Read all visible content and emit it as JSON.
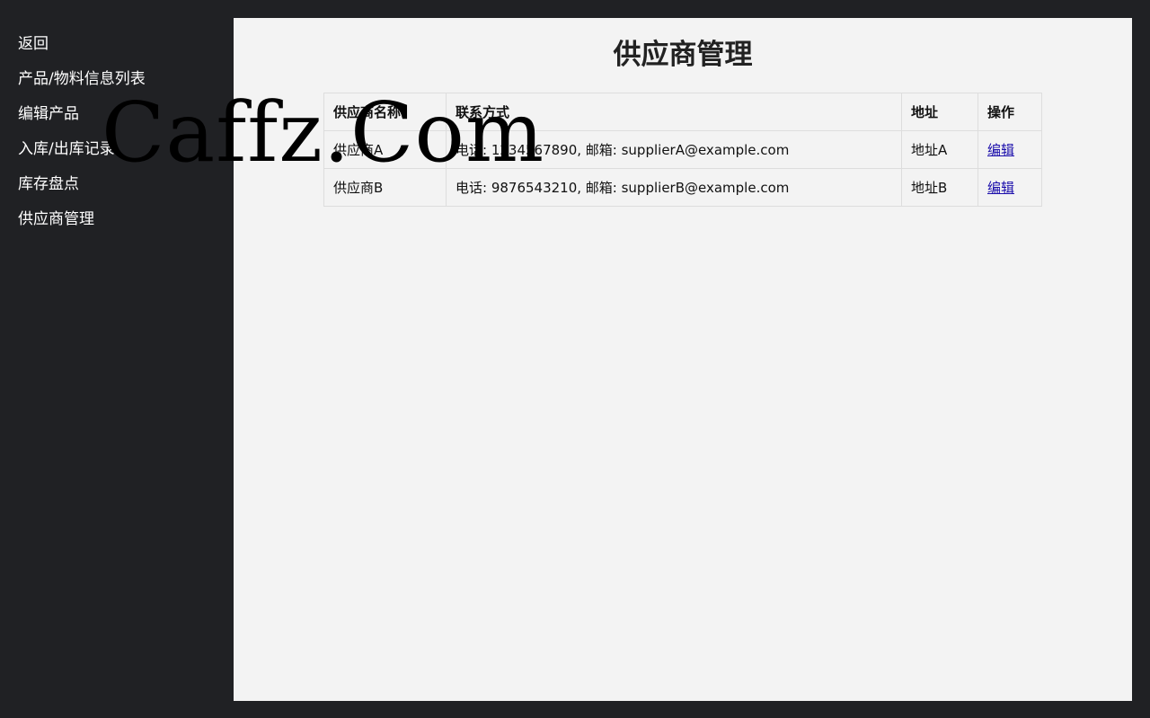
{
  "sidebar": {
    "items": [
      {
        "label": "返回"
      },
      {
        "label": "产品/物料信息列表"
      },
      {
        "label": "编辑产品"
      },
      {
        "label": "入库/出库记录"
      },
      {
        "label": "库存盘点"
      },
      {
        "label": "供应商管理"
      }
    ]
  },
  "main": {
    "title": "供应商管理",
    "table": {
      "headers": [
        "供应商名称",
        "联系方式",
        "地址",
        "操作"
      ],
      "rows": [
        {
          "name": "供应商A",
          "contact": "电话: 1234567890, 邮箱: supplierA@example.com",
          "address": "地址A",
          "action": "编辑"
        },
        {
          "name": "供应商B",
          "contact": "电话: 9876543210, 邮箱: supplierB@example.com",
          "address": "地址B",
          "action": "编辑"
        }
      ]
    }
  },
  "watermark": {
    "text": "Caffz.Com"
  },
  "colors": {
    "sidebar_bg": "#202124",
    "main_bg": "#f3f3f3",
    "link": "#1a0dab"
  }
}
